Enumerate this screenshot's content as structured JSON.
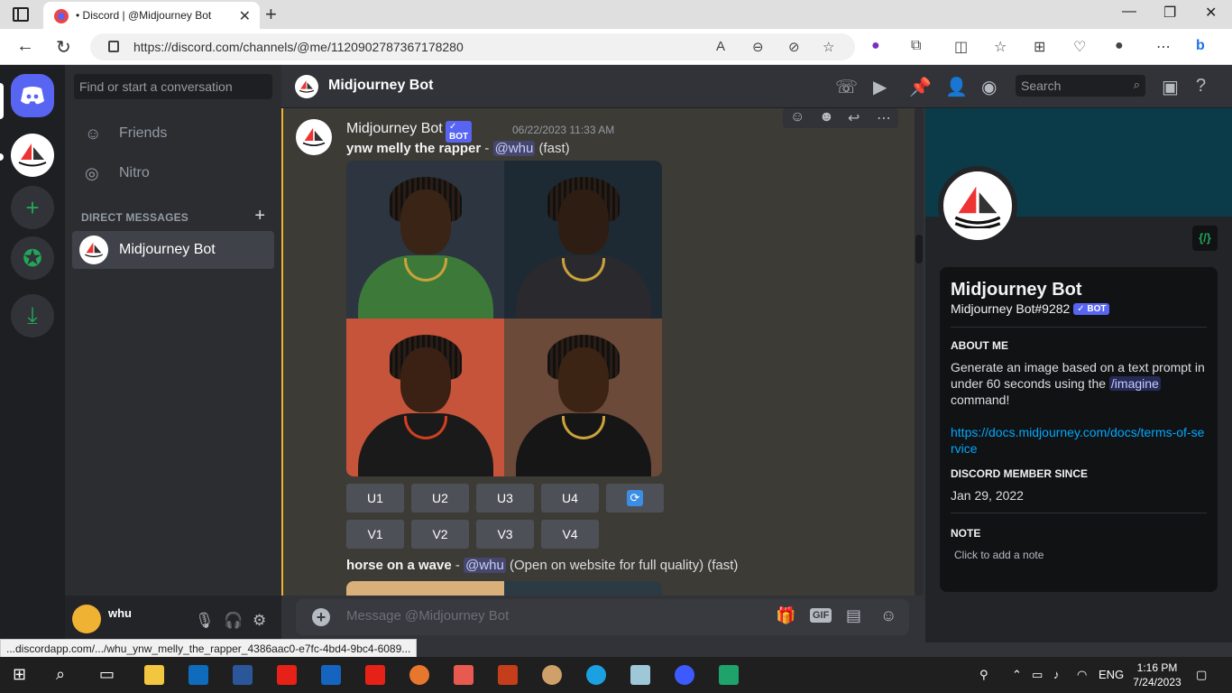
{
  "browser": {
    "tab_title": "• Discord | @Midjourney Bot",
    "url": "https://discord.com/channels/@me/1120902787367178280",
    "status_url": "...discordapp.com/.../whu_ynw_melly_the_rapper_4386aac0-e7fc-4bd4-9bc4-6089..."
  },
  "sidebar": {
    "search_placeholder": "Find or start a conversation",
    "nav": [
      {
        "label": "Friends"
      },
      {
        "label": "Nitro"
      }
    ],
    "dm_header": "DIRECT MESSAGES",
    "dm_items": [
      {
        "name": "Midjourney Bot"
      }
    ],
    "user": {
      "name": "whu"
    }
  },
  "channel": {
    "title": "Midjourney Bot",
    "search_placeholder": "Search"
  },
  "messages": [
    {
      "author": "Midjourney Bot",
      "badge": "✓ BOT",
      "timestamp": "06/22/2023 11:33 AM",
      "prompt": "ynw melly the rapper",
      "sep": " - ",
      "mention": "@whu",
      "suffix": "(fast)",
      "upscale_buttons": [
        "U1",
        "U2",
        "U3",
        "U4"
      ],
      "variation_buttons": [
        "V1",
        "V2",
        "V3",
        "V4"
      ]
    },
    {
      "prompt": "horse on a wave",
      "sep": " - ",
      "mention": "@whu",
      "suffix": "(Open on website for full quality) (fast)"
    }
  ],
  "composer": {
    "placeholder": "Message @Midjourney Bot",
    "gif_label": "GIF"
  },
  "profile": {
    "name": "Midjourney Bot",
    "tag": "Midjourney Bot#9282",
    "badge": "✓ BOT",
    "code_badge": "{/}",
    "about_heading": "ABOUT ME",
    "about_text_1": "Generate an image based on a text prompt in under 60 seconds using the ",
    "about_command": "/imagine",
    "about_text_2": " command!",
    "link": "https://docs.midjourney.com/docs/terms-of-service",
    "member_since_heading": "DISCORD MEMBER SINCE",
    "member_since": "Jan 29, 2022",
    "note_heading": "NOTE",
    "note_placeholder": "Click to add a note"
  },
  "taskbar": {
    "lang": "ENG",
    "time": "1:16 PM",
    "date": "7/24/2023"
  },
  "colors": {
    "blurple": "#5865f2",
    "green": "#23a559",
    "link": "#00a8fc",
    "highlight": "#f0b232"
  }
}
